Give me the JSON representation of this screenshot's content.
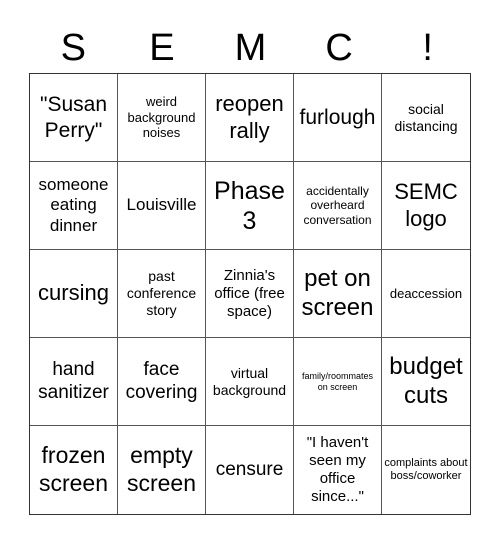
{
  "header": {
    "letters": [
      "S",
      "E",
      "M",
      "C",
      "!"
    ]
  },
  "cells": [
    "\"Susan Perry\"",
    "weird background noises",
    "reopen rally",
    "furlough",
    "social distancing",
    "someone eating dinner",
    "Louisville",
    "Phase 3",
    "accidentally overheard conversation",
    "SEMC logo",
    "cursing",
    "past conference story",
    "Zinnia's office (free space)",
    "pet on screen",
    "deaccession",
    "hand sanitizer",
    "face covering",
    "virtual background",
    "family/roommates on screen",
    "budget cuts",
    "frozen screen",
    "empty screen",
    "censure",
    "\"I haven't seen my office since...\"",
    "complaints about boss/coworker"
  ]
}
